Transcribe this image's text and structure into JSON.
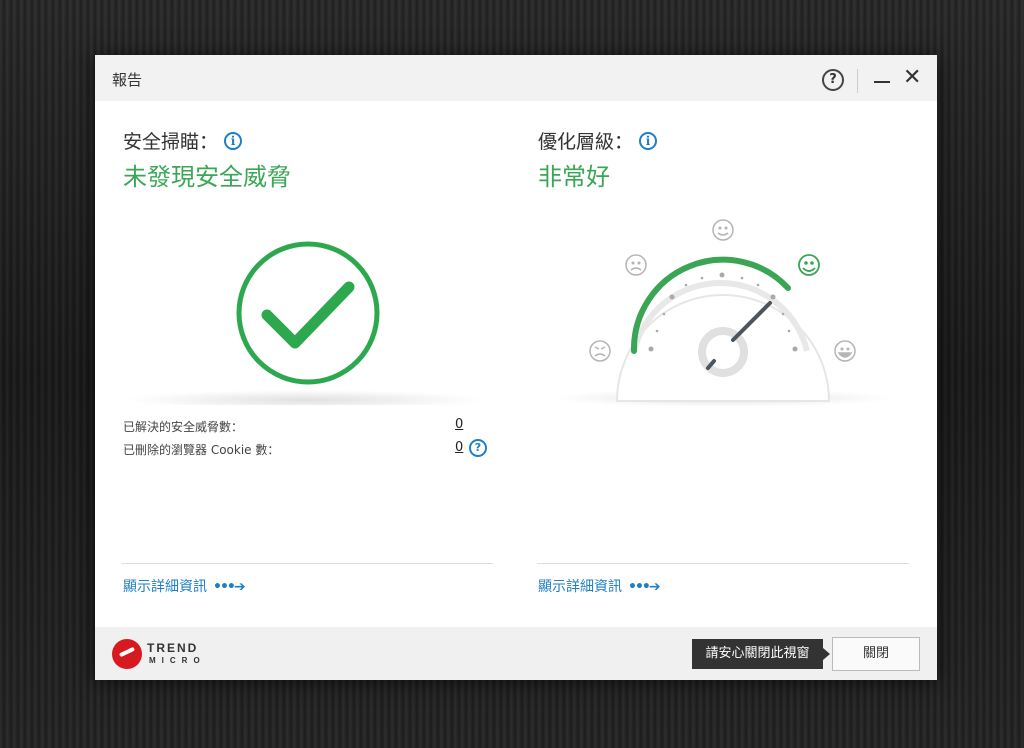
{
  "window": {
    "title": "報告"
  },
  "titlebar": {
    "help": "?",
    "close": "✕"
  },
  "left_panel": {
    "title": "安全掃瞄：",
    "info": "i",
    "status": "未發現安全威脅",
    "stats": [
      {
        "label": "已解決的安全威脅數：",
        "value": "0"
      },
      {
        "label": "已刪除的瀏覽器 Cookie 數：",
        "value": "0"
      }
    ],
    "help": "?",
    "details_link": "顯示詳細資訊"
  },
  "right_panel": {
    "title": "優化層級：",
    "info": "i",
    "status": "非常好",
    "gauge_level": "very-good",
    "details_link": "顯示詳細資訊"
  },
  "footer": {
    "logo_word": "TREND",
    "logo_sub": "MICRO",
    "tooltip": "請安心關閉此視窗",
    "close_button": "關閉"
  },
  "colors": {
    "accent_green": "#3aa655",
    "link_blue": "#1e7fc6",
    "brand_red": "#d71920"
  },
  "icons": [
    "help-icon",
    "minimize-icon",
    "close-icon",
    "info-icon",
    "checkmark-icon",
    "gauge-icon",
    "smiley-icon",
    "arrow-right-icon",
    "trend-micro-logo"
  ]
}
